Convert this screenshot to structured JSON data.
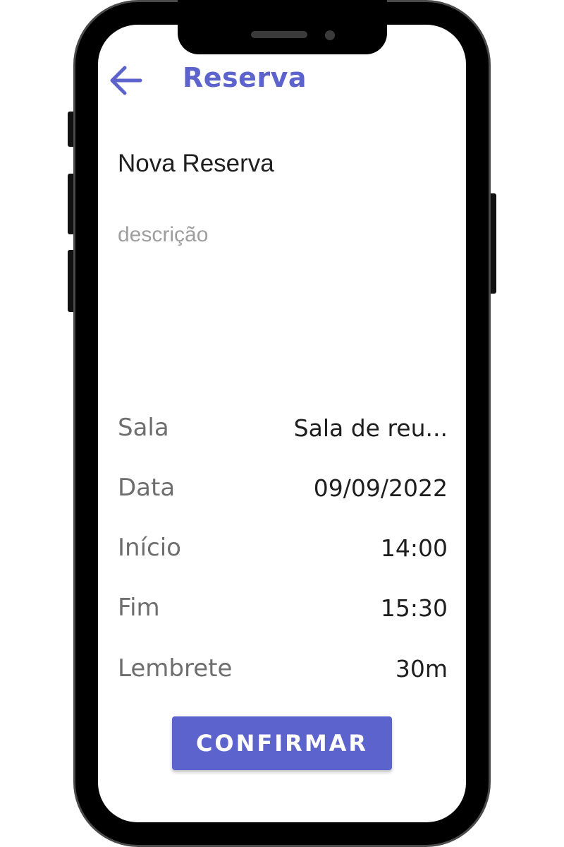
{
  "header": {
    "title": "Reserva",
    "back_icon": "arrow-left-icon"
  },
  "form": {
    "title": "Nova Reserva",
    "description_placeholder": "descrição",
    "description_value": ""
  },
  "details": [
    {
      "label": "Sala",
      "value": "Sala de reu..."
    },
    {
      "label": "Data",
      "value": "09/09/2022"
    },
    {
      "label": "Início",
      "value": "14:00"
    },
    {
      "label": "Fim",
      "value": "15:30"
    },
    {
      "label": "Lembrete",
      "value": "30m"
    }
  ],
  "actions": {
    "confirm_label": "CONFIRMAR"
  },
  "colors": {
    "accent": "#5c63cc",
    "label": "#6e6e6e",
    "value": "#1e1e1e",
    "placeholder": "#9e9e9e",
    "frame": "#000000"
  }
}
